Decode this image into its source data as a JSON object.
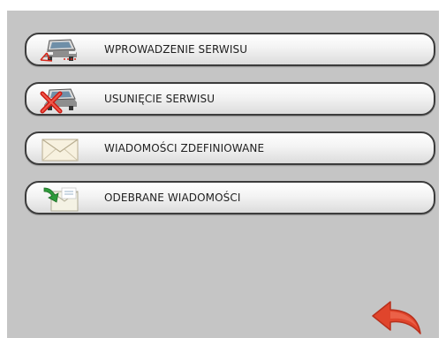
{
  "menu": {
    "items": [
      {
        "label": "WPROWADZENIE SERWISU",
        "icon": "vehicle-add-icon"
      },
      {
        "label": "USUNIĘCIE SERWISU",
        "icon": "vehicle-remove-icon"
      },
      {
        "label": "WIADOMOŚCI ZDEFINIOWANE",
        "icon": "envelope-icon"
      },
      {
        "label": "ODEBRANE WIADOMOŚCI",
        "icon": "received-message-icon"
      }
    ]
  },
  "navigation": {
    "back_icon": "back-arrow-icon"
  },
  "colors": {
    "screen_background": "#c5c5c5",
    "button_border": "#3c3c3c",
    "back_arrow": "#e0452c"
  }
}
